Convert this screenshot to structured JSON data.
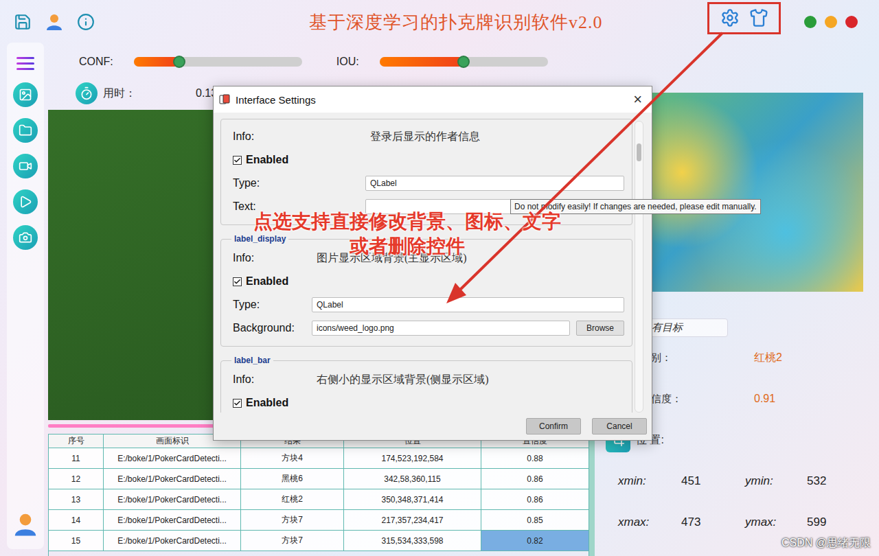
{
  "window": {
    "title": "基于深度学习的扑克牌识别软件v2.0"
  },
  "sliders": [
    {
      "label": "CONF:",
      "level": 0.27
    },
    {
      "label": "IOU:",
      "level": 0.5
    }
  ],
  "timer": {
    "label": "用时：",
    "value": "0.13"
  },
  "table": {
    "columns": [
      "序号",
      "画面标识",
      "结果",
      "位置",
      "置信度"
    ],
    "rows": [
      {
        "cells": [
          "11",
          "E:/boke/1/PokerCardDetecti...",
          "方块4",
          "174,523,192,584",
          "0.88"
        ],
        "selected": false
      },
      {
        "cells": [
          "12",
          "E:/boke/1/PokerCardDetecti...",
          "黑桃6",
          "342,58,360,115",
          "0.86"
        ],
        "selected": false
      },
      {
        "cells": [
          "13",
          "E:/boke/1/PokerCardDetecti...",
          "红桃2",
          "350,348,371,414",
          "0.86"
        ],
        "selected": false
      },
      {
        "cells": [
          "14",
          "E:/boke/1/PokerCardDetecti...",
          "方块7",
          "217,357,234,417",
          "0.85"
        ],
        "selected": false
      },
      {
        "cells": [
          "15",
          "E:/boke/1/PokerCardDetecti...",
          "方块7",
          "315,534,333,598",
          "0.82"
        ],
        "selected": true
      }
    ]
  },
  "details": {
    "target_select": "有目标",
    "fields": [
      {
        "label": "别：",
        "value": "红桃2"
      },
      {
        "label": "信度：",
        "value": "0.91"
      }
    ],
    "position_label": "位 置:",
    "coords": [
      {
        "label": "xmin:",
        "value": "451"
      },
      {
        "label": "ymin:",
        "value": "532"
      },
      {
        "label": "xmax:",
        "value": "473"
      },
      {
        "label": "ymax:",
        "value": "599"
      }
    ]
  },
  "dialog": {
    "title": "Interface Settings",
    "close": "×",
    "groups": [
      {
        "rows": [
          {
            "kind": "info",
            "label": "Info:",
            "value": "登录后显示的作者信息"
          },
          {
            "kind": "check",
            "label": "Enabled",
            "checked": true
          },
          {
            "kind": "field",
            "label": "Type:",
            "value": "QLabel"
          },
          {
            "kind": "field",
            "label": "Text:",
            "value": ""
          }
        ]
      },
      {
        "name": "label_display",
        "rows": [
          {
            "kind": "info",
            "label": "Info:",
            "value": "图片显示区域背景(主显示区域)"
          },
          {
            "kind": "check",
            "label": "Enabled",
            "checked": true
          },
          {
            "kind": "field",
            "label": "Type:",
            "value": "QLabel"
          },
          {
            "kind": "file",
            "label": "Background:",
            "value": "icons/weed_logo.png",
            "button": "Browse"
          }
        ]
      },
      {
        "name": "label_bar",
        "rows": [
          {
            "kind": "info",
            "label": "Info:",
            "value": "右侧小的显示区域背景(侧显示区域)"
          },
          {
            "kind": "check",
            "label": "Enabled",
            "checked": true
          }
        ]
      }
    ],
    "buttons": [
      "Confirm",
      "Cancel"
    ],
    "tooltip": "Do not modify easily! If changes are needed, please edit manually."
  },
  "annotation": {
    "lines": [
      "点选支持直接修改背景、图标、文字",
      "或者删除控件"
    ]
  },
  "watermark": "CSDN @思绪无限"
}
